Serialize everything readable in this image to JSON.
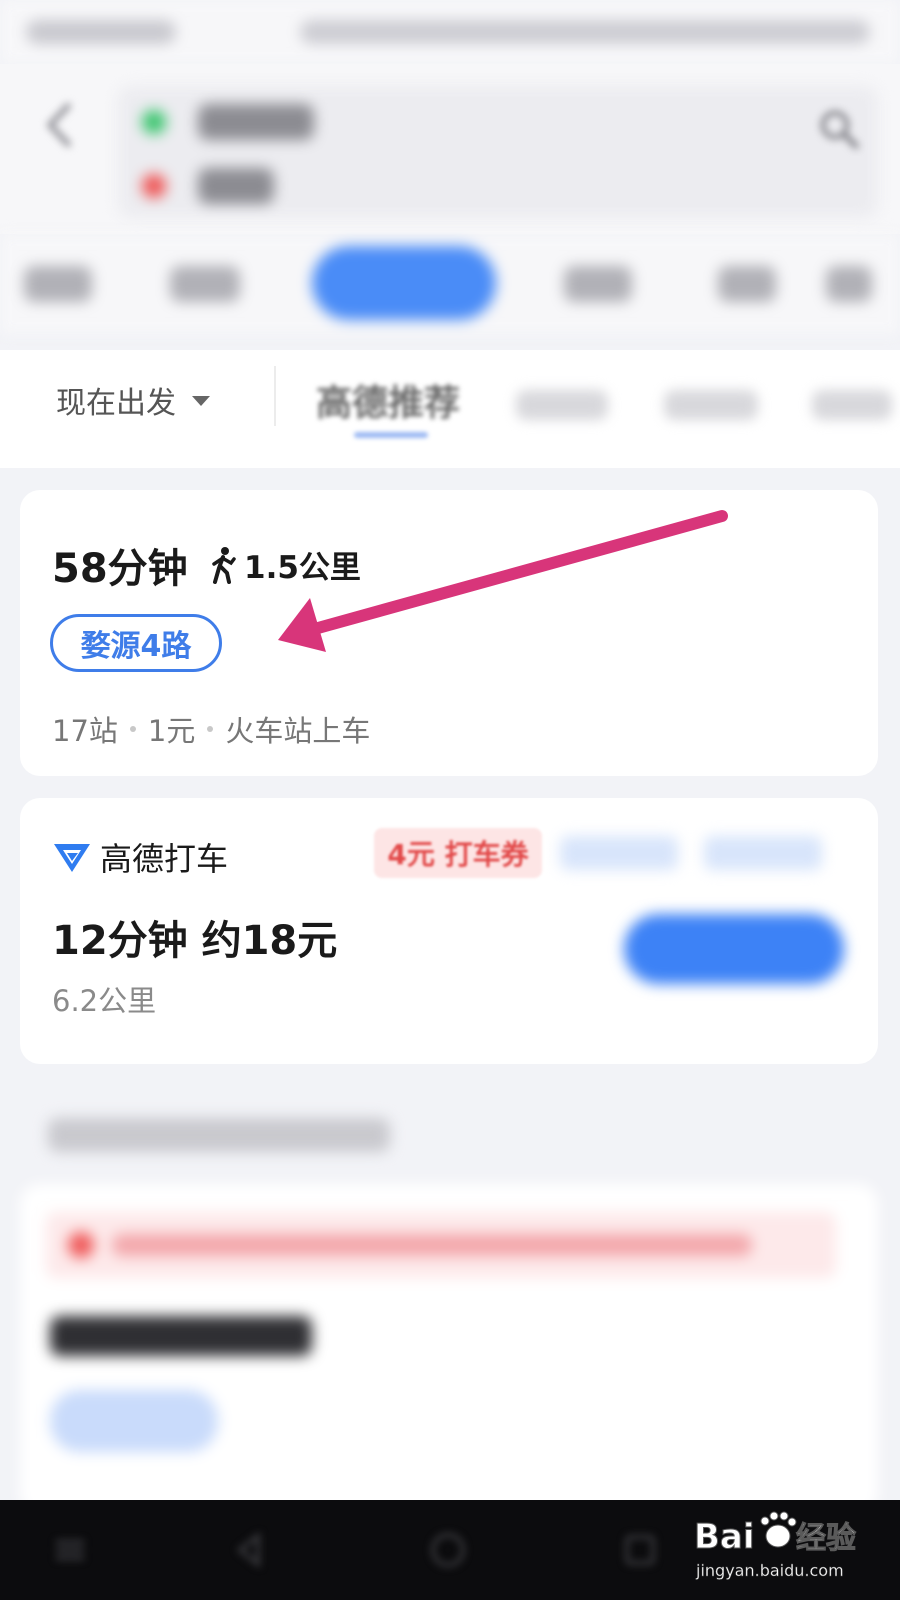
{
  "filter_bar": {
    "depart_label": "现在出发",
    "sort_active_label": "高德推荐"
  },
  "bus_plan": {
    "duration": "58分钟",
    "walk_distance": "1.5公里",
    "line_name": "婺源4路",
    "stops": "17站",
    "fare": "1元",
    "boarding": "火车站上车"
  },
  "taxi_plan": {
    "brand": "高德打车",
    "coupon": "4元 打车券",
    "eta_price": "12分钟 约18元",
    "distance": "6.2公里"
  },
  "watermark": {
    "brand": "Bai",
    "brand_cn": "经验",
    "url": "jingyan.baidu.com"
  },
  "colors": {
    "accent_blue": "#3f7de9",
    "coupon_red": "#e24a4a",
    "annotation_arrow": "#d8357a"
  },
  "icons": {
    "back": "chevron-left-icon",
    "search": "search-icon",
    "walk": "walking-person-icon",
    "taxi_logo": "gaode-taxi-logo-icon"
  }
}
